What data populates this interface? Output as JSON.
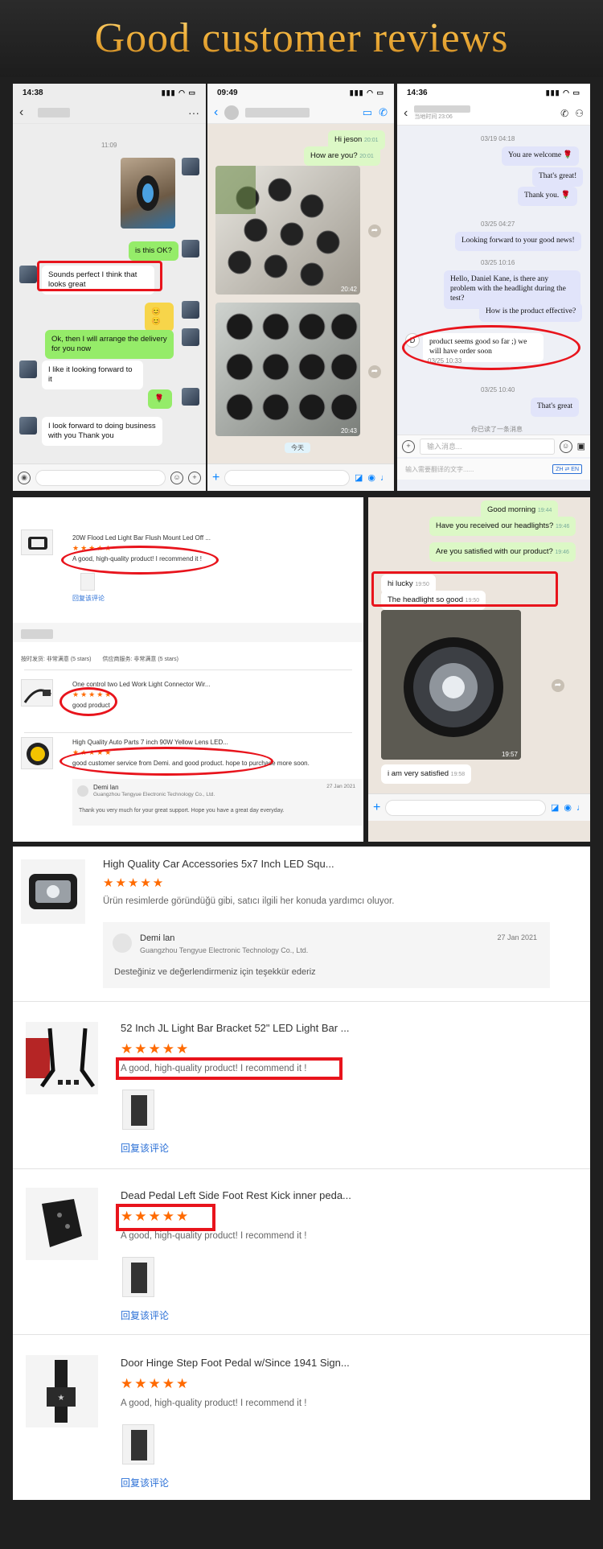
{
  "header": {
    "title": "Good customer reviews"
  },
  "chat1": {
    "time": "14:38",
    "date_label": "11:09",
    "messages": [
      {
        "text": "is this OK?"
      },
      {
        "text": "Sounds perfect I think that looks great"
      },
      {
        "text": "Ok, then I will arrange the delivery for you now"
      },
      {
        "text": "I like it looking forward to it"
      },
      {
        "text": "I look forward to doing business with you Thank you"
      }
    ]
  },
  "chat2": {
    "time": "09:49",
    "messages": [
      {
        "text": "Hi jeson",
        "ts": "20:01"
      },
      {
        "text": "How are you?",
        "ts": "20:01"
      }
    ],
    "photo1_ts": "20:42",
    "photo2_ts": "20:43",
    "day_label": "今天"
  },
  "chat3": {
    "time": "14:36",
    "subtitle": "当地时间 23:06",
    "messages": [
      {
        "ts": "03/19 04:18",
        "text": "You are welcome"
      },
      {
        "text": "That's great!"
      },
      {
        "text": "Thank you."
      },
      {
        "ts": "03/25 04:27",
        "text": "Looking forward to your good news!"
      },
      {
        "ts": "03/25 10:16",
        "text": "Hello, Daniel Kane, is there any problem with the headlight during the test?"
      },
      {
        "text": "How is the product effective?"
      },
      {
        "text": "product seems good so far ;) we will have order soon",
        "ts": "03/25 10:33"
      },
      {
        "ts": "03/25 10:40",
        "text": "That's great"
      }
    ],
    "seen_label": "你已读了一条消息",
    "input_placeholder": "输入消息...",
    "translate_placeholder": "输入需要翻译的文字......",
    "lang_badge": "ZH ⇄ EN",
    "avatar_letter": "D"
  },
  "reviews_panel": {
    "item1_title": "20W Flood Led Light Bar Flush Mount Led Off ...",
    "item1_text": "A good, high-quality product! I recommend it !",
    "item1_reply": "回复该评论",
    "rating_row": "按时发货: 非常满意 (5 stars)　　供应商服务: 非常满意 (5 stars)",
    "item2_title": "One control two Led Work Light Connector Wir...",
    "item2_text": "good product",
    "item3_title": "High Quality Auto Parts 7 inch 90W Yellow Lens LED...",
    "item3_text": "good customer service from Demi.  and good product.  hope to purchase more soon.",
    "seller_name": "Demi lan",
    "seller_company": "Guangzhou Tengyue Electronic Technology Co., Ltd.",
    "seller_date": "27 Jan 2021",
    "seller_reply": "Thank you very much for your great support. Hope you have a great day everyday."
  },
  "chat4": {
    "messages": [
      {
        "text": "Good morning",
        "ts": "19:44"
      },
      {
        "text": "Have you received our headlights?",
        "ts": "19:46"
      },
      {
        "text": "Are you satisfied with our product?",
        "ts": "19:46"
      },
      {
        "text": "hi lucky",
        "ts": "19:50"
      },
      {
        "text": "The headlight so good",
        "ts": "19:50"
      },
      {
        "text": "i am very satisfied",
        "ts": "19:58"
      }
    ],
    "photo_ts": "19:57"
  },
  "big_reviews": [
    {
      "title": "High Quality Car Accessories 5x7 Inch LED Squ...",
      "stars": "★★★★★",
      "text": "Ürün resimlerde göründüğü gibi, satıcı ilgili her konuda yardımcı oluyor.",
      "seller_name": "Demi lan",
      "seller_company": "Guangzhou Tengyue Electronic Technology Co., Ltd.",
      "seller_date": "27 Jan 2021",
      "seller_reply": "Desteğiniz ve değerlendirmeniz için teşekkür ederiz"
    },
    {
      "title": "52 Inch JL Light Bar Bracket 52\" LED Light Bar ...",
      "stars": "★★★★★",
      "text": "A good, high-quality product! I recommend it !",
      "reply": "回复该评论"
    },
    {
      "title": "Dead Pedal Left Side Foot Rest Kick inner peda...",
      "stars": "★★★★★",
      "text": "A good, high-quality product! I recommend it !",
      "reply": "回复该评论"
    },
    {
      "title": "Door Hinge Step Foot Pedal w/Since 1941 Sign...",
      "stars": "★★★★★",
      "text": "A good, high-quality product! I recommend it !",
      "reply": "回复该评论"
    }
  ],
  "colors": {
    "accent_red": "#e8141c",
    "star_orange": "#ff6a00",
    "link_blue": "#2a6fd6",
    "gold": "#e6a93a"
  }
}
